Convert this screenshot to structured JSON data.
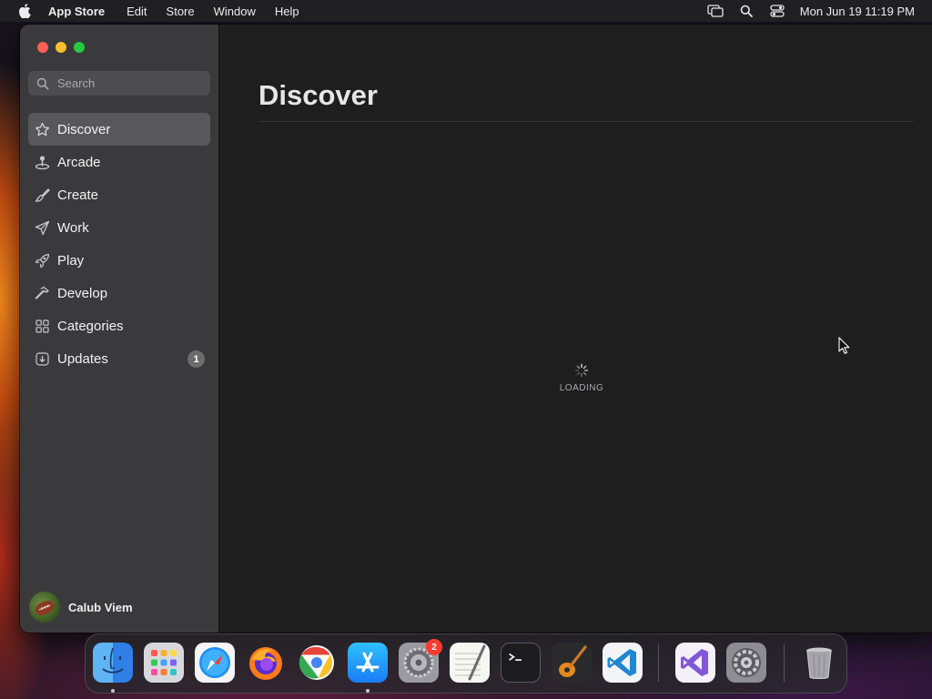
{
  "menubar": {
    "app_name": "App Store",
    "menus": [
      "Edit",
      "Store",
      "Window",
      "Help"
    ],
    "clock": "Mon Jun 19  11:19 PM",
    "status_icons": [
      "screen-mirroring-icon",
      "spotlight-search-icon",
      "control-center-icon"
    ]
  },
  "sidebar": {
    "search_placeholder": "Search",
    "items": [
      {
        "label": "Discover",
        "icon": "star-icon",
        "active": true
      },
      {
        "label": "Arcade",
        "icon": "joystick-icon",
        "active": false
      },
      {
        "label": "Create",
        "icon": "brush-icon",
        "active": false
      },
      {
        "label": "Work",
        "icon": "paper-plane-icon",
        "active": false
      },
      {
        "label": "Play",
        "icon": "rocket-icon",
        "active": false
      },
      {
        "label": "Develop",
        "icon": "hammer-icon",
        "active": false
      },
      {
        "label": "Categories",
        "icon": "grid-icon",
        "active": false
      },
      {
        "label": "Updates",
        "icon": "download-icon",
        "active": false,
        "badge": "1"
      }
    ],
    "user_name": "Calub Viem"
  },
  "main": {
    "title": "Discover",
    "loading_text": "LOADING"
  },
  "dock": {
    "apps": [
      {
        "name": "Finder",
        "icon": "finder-icon",
        "running": true
      },
      {
        "name": "Launchpad",
        "icon": "launchpad-icon",
        "running": false
      },
      {
        "name": "Safari",
        "icon": "safari-icon",
        "running": false
      },
      {
        "name": "Firefox",
        "icon": "firefox-icon",
        "running": false
      },
      {
        "name": "Chrome",
        "icon": "chrome-icon",
        "running": false
      },
      {
        "name": "App Store",
        "icon": "app-store-icon",
        "running": true
      },
      {
        "name": "System Preferences",
        "icon": "system-preferences-icon",
        "running": false,
        "badge": "2"
      },
      {
        "name": "TextEdit",
        "icon": "textedit-icon",
        "running": false
      },
      {
        "name": "Terminal",
        "icon": "terminal-icon",
        "running": false
      },
      {
        "name": "GarageBand",
        "icon": "garageband-icon",
        "running": false
      },
      {
        "name": "Visual Studio Code",
        "icon": "vscode-icon",
        "running": false
      },
      {
        "name": "Visual Studio",
        "icon": "visual-studio-icon",
        "running": false
      },
      {
        "name": "System Settings",
        "icon": "settings-gear-icon",
        "running": false
      },
      {
        "name": "Trash",
        "icon": "trash-icon",
        "running": false
      }
    ]
  },
  "colors": {
    "sidebar_bg": "#3a3a3c",
    "main_bg": "#1e1e1e",
    "active_item_bg": "#58585b",
    "close": "#fe5f57",
    "minimize": "#febc2e",
    "zoom": "#28c840",
    "badge_red": "#ff3b30"
  }
}
